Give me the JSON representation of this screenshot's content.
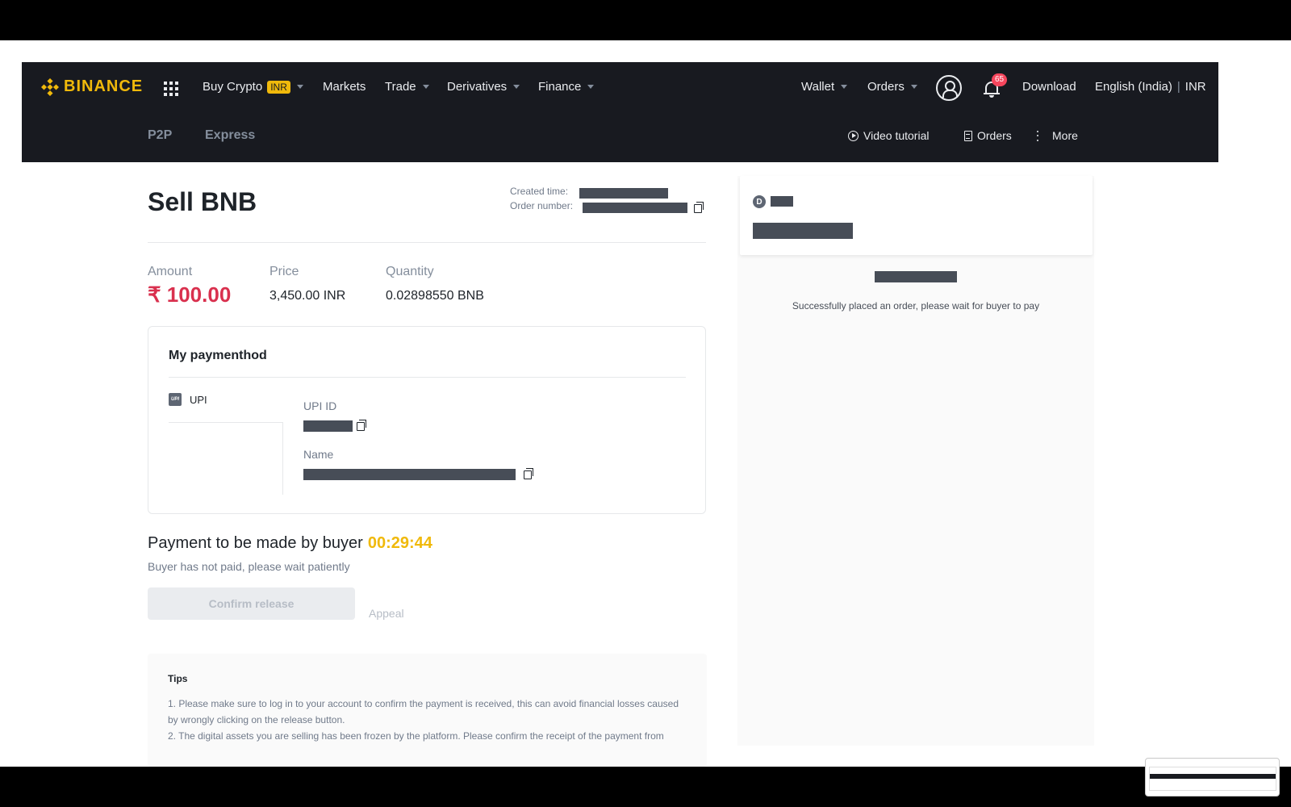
{
  "header": {
    "logo": "BINANCE",
    "nav": [
      {
        "label": "Buy Crypto",
        "badge": "INR"
      },
      {
        "label": "Markets"
      },
      {
        "label": "Trade"
      },
      {
        "label": "Derivatives"
      },
      {
        "label": "Finance"
      }
    ],
    "right": {
      "wallet": "Wallet",
      "orders": "Orders",
      "notification_count": "65",
      "download": "Download",
      "language": "English (India)",
      "separator": "|",
      "currency": "INR"
    }
  },
  "subnav": {
    "tabs": [
      "P2P",
      "Express"
    ],
    "video_tutorial": "Video tutorial",
    "orders": "Orders",
    "more": "More"
  },
  "order": {
    "title": "Sell BNB",
    "created_time_label": "Created time:",
    "order_number_label": "Order number:",
    "amount_label": "Amount",
    "amount_value": "₹ 100.00",
    "price_label": "Price",
    "price_value": "3,450.00 INR",
    "quantity_label": "Quantity",
    "quantity_value": "0.02898550 BNB"
  },
  "payment_method": {
    "title": "My paymenthod",
    "method": "UPI",
    "upi_id_label": "UPI ID",
    "name_label": "Name"
  },
  "status": {
    "heading": "Payment to be made by buyer",
    "timer": "00:29:44",
    "subtext": "Buyer has not paid, please wait patiently",
    "confirm_button": "Confirm release",
    "appeal": "Appeal"
  },
  "tips": {
    "title": "Tips",
    "items": [
      "1. Please make sure to log in to your account to confirm the payment is received, this can avoid financial losses caused by wrongly clicking on the release button.",
      "2. The digital assets you are selling has been frozen by the platform. Please confirm the receipt of the payment from"
    ]
  },
  "counterparty": {
    "avatar_letter": "D"
  },
  "chat": {
    "status_message": "Successfully placed an order, please wait for buyer to pay"
  }
}
